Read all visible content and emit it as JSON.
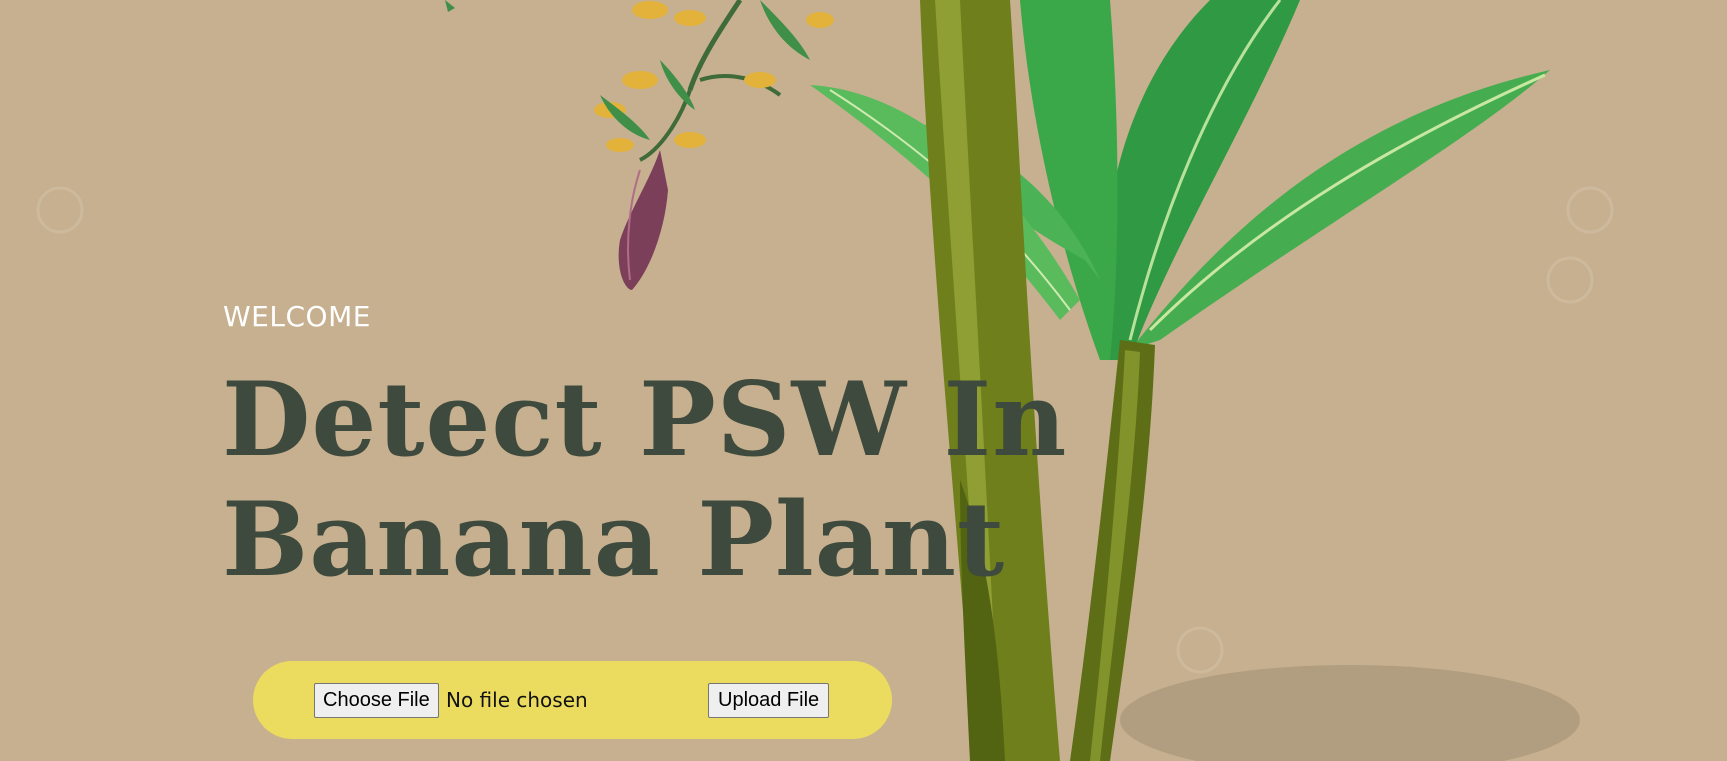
{
  "hero": {
    "welcome": "WELCOME",
    "title_line1": "Detect PSW In",
    "title_line2": "Banana Plant"
  },
  "upload": {
    "choose_label": "Choose File",
    "status": "No file chosen",
    "submit_label": "Upload File"
  },
  "colors": {
    "background": "#c6b08f",
    "title": "#3e4a3d",
    "pill": "#ebdc5f",
    "stem": "#6b7a1f",
    "leaf": "#3fa84a"
  }
}
